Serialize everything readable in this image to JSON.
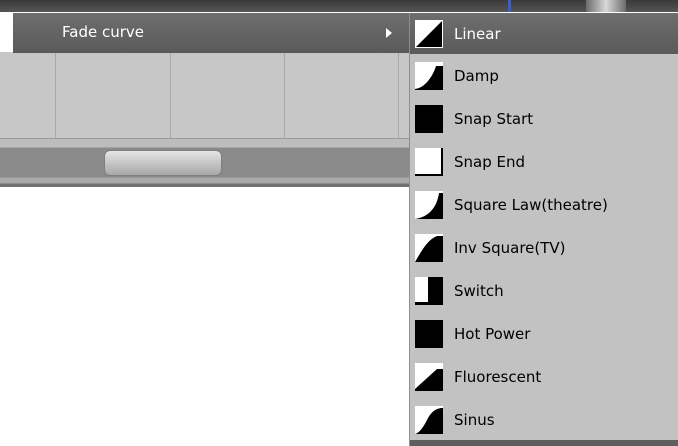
{
  "parent_menu": {
    "label": "Fade curve"
  },
  "submenu": {
    "items": [
      {
        "label": "Linear",
        "icon": "linear-curve-icon",
        "selected": true
      },
      {
        "label": "Damp",
        "icon": "damp-curve-icon",
        "selected": false
      },
      {
        "label": "Snap Start",
        "icon": "snap-start-curve-icon",
        "selected": false
      },
      {
        "label": "Snap End",
        "icon": "snap-end-curve-icon",
        "selected": false
      },
      {
        "label": "Square Law(theatre)",
        "icon": "square-law-curve-icon",
        "selected": false
      },
      {
        "label": "Inv Square(TV)",
        "icon": "inv-square-curve-icon",
        "selected": false
      },
      {
        "label": "Switch",
        "icon": "switch-curve-icon",
        "selected": false
      },
      {
        "label": "Hot Power",
        "icon": "hot-power-curve-icon",
        "selected": false
      },
      {
        "label": "Fluorescent",
        "icon": "fluorescent-curve-icon",
        "selected": false
      },
      {
        "label": "Sinus",
        "icon": "sinus-curve-icon",
        "selected": false
      }
    ]
  },
  "colors": {
    "menu_background": "#c2c2c2",
    "selected_background": "#636363",
    "selected_text": "#ffffff",
    "item_text": "#000000"
  }
}
